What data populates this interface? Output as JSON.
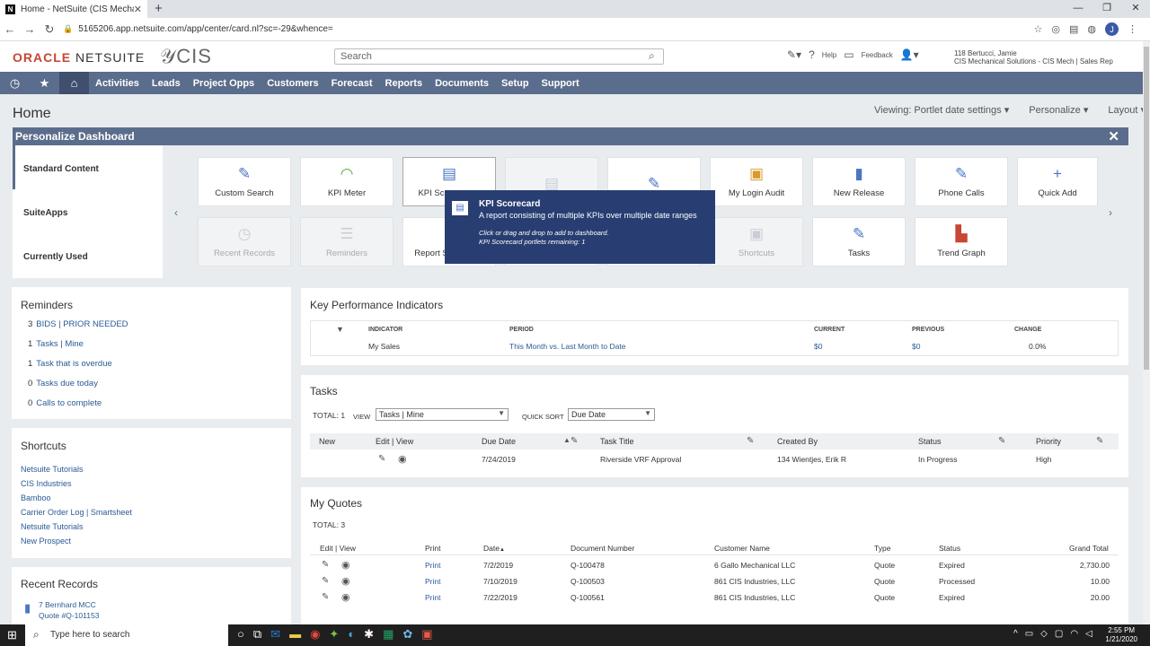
{
  "browser": {
    "tab_title": "Home - NetSuite (CIS Mechanica",
    "tab_favicon": "N",
    "url": "5165206.app.netsuite.com/app/center/card.nl?sc=-29&whence=",
    "profile_initial": "J"
  },
  "header": {
    "logo_oracle": "ORACLE",
    "logo_netsuite": "NETSUITE",
    "company_logo": "CIS",
    "search_placeholder": "Search",
    "help": "Help",
    "feedback": "Feedback",
    "user_name": "118 Bertucci, Jamie",
    "user_role": "CIS Mechanical Solutions - CIS Mech | Sales Rep"
  },
  "nav": {
    "items": [
      "Activities",
      "Leads",
      "Project Opps",
      "Customers",
      "Forecast",
      "Reports",
      "Documents",
      "Setup",
      "Support"
    ]
  },
  "page": {
    "title": "Home",
    "viewing": "Viewing: Portlet date settings",
    "personalize": "Personalize",
    "layout": "Layout"
  },
  "personalize_panel": {
    "title": "Personalize Dashboard",
    "categories": [
      "Standard Content",
      "SuiteApps",
      "Currently Used"
    ],
    "tiles_row1": [
      "Custom Search",
      "KPI Meter",
      "KPI Sc",
      "",
      "",
      "My Login Audit",
      "New Release",
      "Phone Calls",
      "Quick Add"
    ],
    "tiles_row2": [
      "Recent Records",
      "Reminders",
      "Report S",
      "",
      "",
      "Shortcuts",
      "Tasks",
      "Trend Graph"
    ]
  },
  "tooltip": {
    "title": "KPI Scorecard",
    "body": "A report consisting of multiple KPIs over multiple date ranges",
    "hint1": "Click or drag and drop to add to dashboard.",
    "hint2": "KPI Scorecard portlets remaining: 1"
  },
  "reminders": {
    "title": "Reminders",
    "items": [
      {
        "count": "3",
        "label": "BIDS | PRIOR NEEDED"
      },
      {
        "count": "1",
        "label": "Tasks | Mine"
      },
      {
        "count": "1",
        "label": "Task that is overdue"
      },
      {
        "count": "0",
        "label": "Tasks due today"
      },
      {
        "count": "0",
        "label": "Calls to complete"
      }
    ]
  },
  "shortcuts": {
    "title": "Shortcuts",
    "items": [
      "Netsuite Tutorials",
      "CIS Industries",
      "Bamboo",
      "Carrier Order Log | Smartsheet",
      "Netsuite Tutorials",
      "New Prospect"
    ]
  },
  "recent_records": {
    "title": "Recent Records",
    "items": [
      {
        "line1": "7 Bernhard MCC",
        "line2": "Quote #Q-101153"
      }
    ]
  },
  "kpi": {
    "title": "Key Performance Indicators",
    "headers": [
      "INDICATOR",
      "PERIOD",
      "CURRENT",
      "PREVIOUS",
      "CHANGE"
    ],
    "rows": [
      {
        "indicator": "My Sales",
        "period": "This Month vs. Last Month to Date",
        "current": "$0",
        "previous": "$0",
        "change": "0.0%"
      }
    ]
  },
  "tasks": {
    "title": "Tasks",
    "total": "TOTAL: 1",
    "view_label": "VIEW",
    "view_value": "Tasks | Mine",
    "sort_label": "QUICK SORT",
    "sort_value": "Due Date",
    "headers": [
      "New",
      "Edit | View",
      "Due Date",
      "Task Title",
      "Created By",
      "Status",
      "Priority"
    ],
    "rows": [
      {
        "due": "7/24/2019",
        "title": "Riverside VRF Approval",
        "created_by": "134 Wientjes, Erik R",
        "status": "In Progress",
        "priority": "High"
      }
    ]
  },
  "quotes": {
    "title": "My Quotes",
    "total": "TOTAL: 3",
    "headers": [
      "Edit | View",
      "Print",
      "Date",
      "Document Number",
      "Customer Name",
      "Type",
      "Status",
      "Grand Total"
    ],
    "rows": [
      {
        "print": "Print",
        "date": "7/2/2019",
        "doc": "Q-100478",
        "customer": "6 Gallo Mechanical LLC",
        "type": "Quote",
        "status": "Expired",
        "total": "2,730.00"
      },
      {
        "print": "Print",
        "date": "7/10/2019",
        "doc": "Q-100503",
        "customer": "861 CIS Industries, LLC",
        "type": "Quote",
        "status": "Processed",
        "total": "10.00"
      },
      {
        "print": "Print",
        "date": "7/22/2019",
        "doc": "Q-100561",
        "customer": "861 CIS Industries, LLC",
        "type": "Quote",
        "status": "Expired",
        "total": "20.00"
      }
    ]
  },
  "taskbar": {
    "search_placeholder": "Type here to search",
    "time": "2:55 PM",
    "date": "1/21/2020"
  }
}
